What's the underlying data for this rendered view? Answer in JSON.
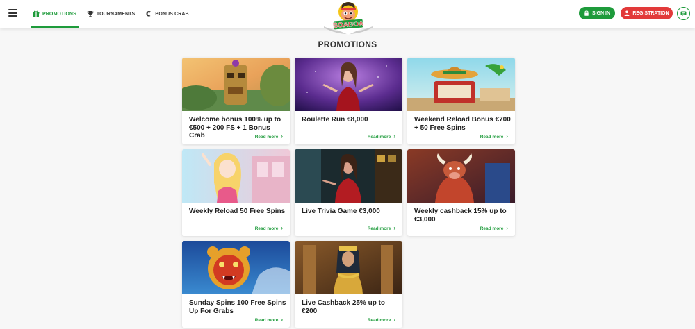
{
  "nav": {
    "items": [
      {
        "label": "PROMOTIONS",
        "icon": "gift-icon",
        "active": true
      },
      {
        "label": "TOURNAMENTS",
        "icon": "trophy-icon",
        "active": false
      },
      {
        "label": "BONUS CRAB",
        "icon": "crab-claw-icon",
        "active": false
      }
    ]
  },
  "logo": {
    "text": "BOABOA"
  },
  "auth": {
    "signin_label": "SIGN IN",
    "register_label": "REGISTRATION"
  },
  "page": {
    "title": "PROMOTIONS"
  },
  "colors": {
    "brand_green": "#1e9b3b",
    "register_red": "#e23a3a"
  },
  "promotions": [
    {
      "title": "Welcome bonus 100% up to €500 + 200 FS + 1 Bonus Crab",
      "read_more": "Read more"
    },
    {
      "title": "Roulette Run €8,000",
      "read_more": "Read more"
    },
    {
      "title": "Weekend Reload Bonus €700 + 50 Free Spins",
      "read_more": "Read more"
    },
    {
      "title": "Weekly Reload 50 Free Spins",
      "read_more": "Read more"
    },
    {
      "title": "Live Trivia Game €3,000",
      "read_more": "Read more"
    },
    {
      "title": "Weekly cashback 15% up to €3,000",
      "read_more": "Read more"
    },
    {
      "title": "Sunday Spins 100 Free Spins Up For Grabs",
      "read_more": "Read more"
    },
    {
      "title": "Live Cashback 25% up to €200",
      "read_more": "Read more"
    }
  ]
}
